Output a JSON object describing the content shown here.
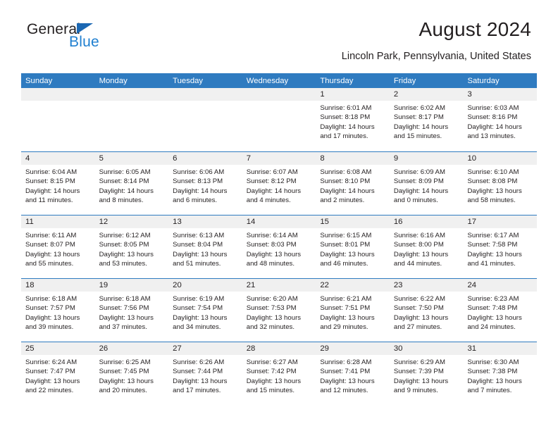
{
  "brand": {
    "name_dark": "General",
    "name_light": "Blue",
    "triangle_color": "#1b68b3",
    "blue_color": "#1f7fd0"
  },
  "header": {
    "title": "August 2024",
    "subtitle": "Lincoln Park, Pennsylvania, United States"
  },
  "theme": {
    "header_blue": "#2f7bc0",
    "day_band_gray": "#f0f0f0",
    "text": "#231f20"
  },
  "calendar": {
    "weekdays": [
      "Sunday",
      "Monday",
      "Tuesday",
      "Wednesday",
      "Thursday",
      "Friday",
      "Saturday"
    ],
    "weeks": [
      [
        {
          "day": "",
          "sunrise": "",
          "sunset": "",
          "daylight1": "",
          "daylight2": ""
        },
        {
          "day": "",
          "sunrise": "",
          "sunset": "",
          "daylight1": "",
          "daylight2": ""
        },
        {
          "day": "",
          "sunrise": "",
          "sunset": "",
          "daylight1": "",
          "daylight2": ""
        },
        {
          "day": "",
          "sunrise": "",
          "sunset": "",
          "daylight1": "",
          "daylight2": ""
        },
        {
          "day": "1",
          "sunrise": "Sunrise: 6:01 AM",
          "sunset": "Sunset: 8:18 PM",
          "daylight1": "Daylight: 14 hours",
          "daylight2": "and 17 minutes."
        },
        {
          "day": "2",
          "sunrise": "Sunrise: 6:02 AM",
          "sunset": "Sunset: 8:17 PM",
          "daylight1": "Daylight: 14 hours",
          "daylight2": "and 15 minutes."
        },
        {
          "day": "3",
          "sunrise": "Sunrise: 6:03 AM",
          "sunset": "Sunset: 8:16 PM",
          "daylight1": "Daylight: 14 hours",
          "daylight2": "and 13 minutes."
        }
      ],
      [
        {
          "day": "4",
          "sunrise": "Sunrise: 6:04 AM",
          "sunset": "Sunset: 8:15 PM",
          "daylight1": "Daylight: 14 hours",
          "daylight2": "and 11 minutes."
        },
        {
          "day": "5",
          "sunrise": "Sunrise: 6:05 AM",
          "sunset": "Sunset: 8:14 PM",
          "daylight1": "Daylight: 14 hours",
          "daylight2": "and 8 minutes."
        },
        {
          "day": "6",
          "sunrise": "Sunrise: 6:06 AM",
          "sunset": "Sunset: 8:13 PM",
          "daylight1": "Daylight: 14 hours",
          "daylight2": "and 6 minutes."
        },
        {
          "day": "7",
          "sunrise": "Sunrise: 6:07 AM",
          "sunset": "Sunset: 8:12 PM",
          "daylight1": "Daylight: 14 hours",
          "daylight2": "and 4 minutes."
        },
        {
          "day": "8",
          "sunrise": "Sunrise: 6:08 AM",
          "sunset": "Sunset: 8:10 PM",
          "daylight1": "Daylight: 14 hours",
          "daylight2": "and 2 minutes."
        },
        {
          "day": "9",
          "sunrise": "Sunrise: 6:09 AM",
          "sunset": "Sunset: 8:09 PM",
          "daylight1": "Daylight: 14 hours",
          "daylight2": "and 0 minutes."
        },
        {
          "day": "10",
          "sunrise": "Sunrise: 6:10 AM",
          "sunset": "Sunset: 8:08 PM",
          "daylight1": "Daylight: 13 hours",
          "daylight2": "and 58 minutes."
        }
      ],
      [
        {
          "day": "11",
          "sunrise": "Sunrise: 6:11 AM",
          "sunset": "Sunset: 8:07 PM",
          "daylight1": "Daylight: 13 hours",
          "daylight2": "and 55 minutes."
        },
        {
          "day": "12",
          "sunrise": "Sunrise: 6:12 AM",
          "sunset": "Sunset: 8:05 PM",
          "daylight1": "Daylight: 13 hours",
          "daylight2": "and 53 minutes."
        },
        {
          "day": "13",
          "sunrise": "Sunrise: 6:13 AM",
          "sunset": "Sunset: 8:04 PM",
          "daylight1": "Daylight: 13 hours",
          "daylight2": "and 51 minutes."
        },
        {
          "day": "14",
          "sunrise": "Sunrise: 6:14 AM",
          "sunset": "Sunset: 8:03 PM",
          "daylight1": "Daylight: 13 hours",
          "daylight2": "and 48 minutes."
        },
        {
          "day": "15",
          "sunrise": "Sunrise: 6:15 AM",
          "sunset": "Sunset: 8:01 PM",
          "daylight1": "Daylight: 13 hours",
          "daylight2": "and 46 minutes."
        },
        {
          "day": "16",
          "sunrise": "Sunrise: 6:16 AM",
          "sunset": "Sunset: 8:00 PM",
          "daylight1": "Daylight: 13 hours",
          "daylight2": "and 44 minutes."
        },
        {
          "day": "17",
          "sunrise": "Sunrise: 6:17 AM",
          "sunset": "Sunset: 7:58 PM",
          "daylight1": "Daylight: 13 hours",
          "daylight2": "and 41 minutes."
        }
      ],
      [
        {
          "day": "18",
          "sunrise": "Sunrise: 6:18 AM",
          "sunset": "Sunset: 7:57 PM",
          "daylight1": "Daylight: 13 hours",
          "daylight2": "and 39 minutes."
        },
        {
          "day": "19",
          "sunrise": "Sunrise: 6:18 AM",
          "sunset": "Sunset: 7:56 PM",
          "daylight1": "Daylight: 13 hours",
          "daylight2": "and 37 minutes."
        },
        {
          "day": "20",
          "sunrise": "Sunrise: 6:19 AM",
          "sunset": "Sunset: 7:54 PM",
          "daylight1": "Daylight: 13 hours",
          "daylight2": "and 34 minutes."
        },
        {
          "day": "21",
          "sunrise": "Sunrise: 6:20 AM",
          "sunset": "Sunset: 7:53 PM",
          "daylight1": "Daylight: 13 hours",
          "daylight2": "and 32 minutes."
        },
        {
          "day": "22",
          "sunrise": "Sunrise: 6:21 AM",
          "sunset": "Sunset: 7:51 PM",
          "daylight1": "Daylight: 13 hours",
          "daylight2": "and 29 minutes."
        },
        {
          "day": "23",
          "sunrise": "Sunrise: 6:22 AM",
          "sunset": "Sunset: 7:50 PM",
          "daylight1": "Daylight: 13 hours",
          "daylight2": "and 27 minutes."
        },
        {
          "day": "24",
          "sunrise": "Sunrise: 6:23 AM",
          "sunset": "Sunset: 7:48 PM",
          "daylight1": "Daylight: 13 hours",
          "daylight2": "and 24 minutes."
        }
      ],
      [
        {
          "day": "25",
          "sunrise": "Sunrise: 6:24 AM",
          "sunset": "Sunset: 7:47 PM",
          "daylight1": "Daylight: 13 hours",
          "daylight2": "and 22 minutes."
        },
        {
          "day": "26",
          "sunrise": "Sunrise: 6:25 AM",
          "sunset": "Sunset: 7:45 PM",
          "daylight1": "Daylight: 13 hours",
          "daylight2": "and 20 minutes."
        },
        {
          "day": "27",
          "sunrise": "Sunrise: 6:26 AM",
          "sunset": "Sunset: 7:44 PM",
          "daylight1": "Daylight: 13 hours",
          "daylight2": "and 17 minutes."
        },
        {
          "day": "28",
          "sunrise": "Sunrise: 6:27 AM",
          "sunset": "Sunset: 7:42 PM",
          "daylight1": "Daylight: 13 hours",
          "daylight2": "and 15 minutes."
        },
        {
          "day": "29",
          "sunrise": "Sunrise: 6:28 AM",
          "sunset": "Sunset: 7:41 PM",
          "daylight1": "Daylight: 13 hours",
          "daylight2": "and 12 minutes."
        },
        {
          "day": "30",
          "sunrise": "Sunrise: 6:29 AM",
          "sunset": "Sunset: 7:39 PM",
          "daylight1": "Daylight: 13 hours",
          "daylight2": "and 9 minutes."
        },
        {
          "day": "31",
          "sunrise": "Sunrise: 6:30 AM",
          "sunset": "Sunset: 7:38 PM",
          "daylight1": "Daylight: 13 hours",
          "daylight2": "and 7 minutes."
        }
      ]
    ]
  }
}
